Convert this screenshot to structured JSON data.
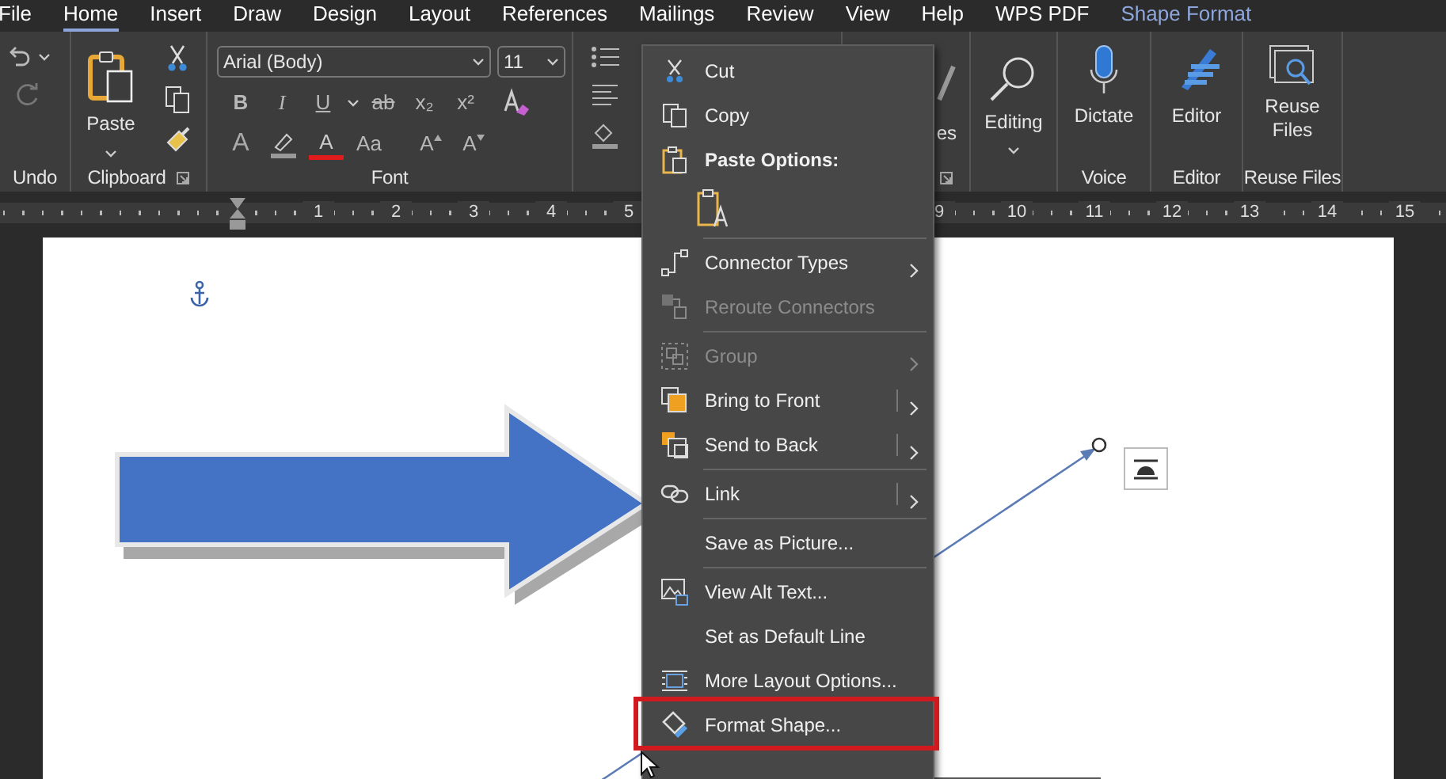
{
  "ribbon_tabs": [
    {
      "label": "File",
      "selected": false,
      "kind": "normal"
    },
    {
      "label": "Home",
      "selected": true,
      "kind": "normal"
    },
    {
      "label": "Insert",
      "selected": false,
      "kind": "normal"
    },
    {
      "label": "Draw",
      "selected": false,
      "kind": "normal"
    },
    {
      "label": "Design",
      "selected": false,
      "kind": "normal"
    },
    {
      "label": "Layout",
      "selected": false,
      "kind": "normal"
    },
    {
      "label": "References",
      "selected": false,
      "kind": "normal"
    },
    {
      "label": "Mailings",
      "selected": false,
      "kind": "normal"
    },
    {
      "label": "Review",
      "selected": false,
      "kind": "normal"
    },
    {
      "label": "View",
      "selected": false,
      "kind": "normal"
    },
    {
      "label": "Help",
      "selected": false,
      "kind": "normal"
    },
    {
      "label": "WPS PDF",
      "selected": false,
      "kind": "normal"
    },
    {
      "label": "Shape Format",
      "selected": false,
      "kind": "contextual"
    }
  ],
  "undo_group": {
    "label": "Undo"
  },
  "clipboard_group": {
    "paste_label": "Paste",
    "label": "Clipboard"
  },
  "font_group": {
    "font_name": "Arial (Body)",
    "font_size": "11",
    "format_buttons": [
      {
        "label": "B",
        "kind": "bold"
      },
      {
        "label": "I",
        "kind": "italic"
      },
      {
        "label": "U",
        "kind": "underline"
      },
      {
        "label": "ab",
        "kind": "strike"
      },
      {
        "label": "x₂",
        "kind": "plain"
      },
      {
        "label": "x²",
        "kind": "plain"
      }
    ],
    "style_buttons": [
      {
        "label": "A",
        "kind": "effects"
      },
      {
        "kind": "highlight"
      },
      {
        "label": "A",
        "kind": "color"
      },
      {
        "label": "Aa",
        "kind": "case"
      },
      {
        "label": "A",
        "kind": "grow"
      },
      {
        "label": "A",
        "kind": "shrink"
      }
    ],
    "label": "Font"
  },
  "styles_group": {
    "button_label": "es"
  },
  "editing_group": {
    "button_label": "Editing"
  },
  "voice_group": {
    "button_label": "Dictate",
    "label": "Voice"
  },
  "editor_group": {
    "button_label": "Editor",
    "label": "Editor"
  },
  "reuse_files_group": {
    "button_label": "Reuse Files",
    "label": "Reuse Files"
  },
  "ruler": {
    "numbers": [
      "1",
      "2",
      "3",
      "4",
      "5",
      "9",
      "10",
      "11",
      "12",
      "13",
      "14",
      "15"
    ]
  },
  "context_menu": {
    "items": [
      {
        "kind": "command",
        "label": "Cut",
        "disabled": false,
        "has_submenu": false,
        "split": false,
        "annotated": false
      },
      {
        "kind": "command",
        "label": "Copy",
        "disabled": false,
        "has_submenu": false,
        "split": false,
        "annotated": false
      },
      {
        "kind": "header",
        "label": "Paste Options:"
      },
      {
        "kind": "paste-options"
      },
      {
        "kind": "separator"
      },
      {
        "kind": "command",
        "label": "Connector Types",
        "disabled": false,
        "has_submenu": true,
        "split": false,
        "annotated": false
      },
      {
        "kind": "command",
        "label": "Reroute Connectors",
        "disabled": true,
        "has_submenu": false,
        "split": false,
        "annotated": false
      },
      {
        "kind": "separator"
      },
      {
        "kind": "command",
        "label": "Group",
        "disabled": true,
        "has_submenu": true,
        "split": false,
        "annotated": false
      },
      {
        "kind": "command",
        "label": "Bring to Front",
        "disabled": false,
        "has_submenu": true,
        "split": true,
        "annotated": false
      },
      {
        "kind": "command",
        "label": "Send to Back",
        "disabled": false,
        "has_submenu": true,
        "split": true,
        "annotated": false
      },
      {
        "kind": "separator"
      },
      {
        "kind": "command",
        "label": "Link",
        "disabled": false,
        "has_submenu": true,
        "split": true,
        "annotated": false
      },
      {
        "kind": "separator"
      },
      {
        "kind": "command",
        "label": "Save as Picture...",
        "disabled": false,
        "has_submenu": false,
        "split": false,
        "annotated": false
      },
      {
        "kind": "separator"
      },
      {
        "kind": "command",
        "label": "View Alt Text...",
        "disabled": false,
        "has_submenu": false,
        "split": false,
        "annotated": false
      },
      {
        "kind": "command",
        "label": "Set as Default Line",
        "disabled": false,
        "has_submenu": false,
        "split": false,
        "annotated": false
      },
      {
        "kind": "command",
        "label": "More Layout Options...",
        "disabled": false,
        "has_submenu": false,
        "split": false,
        "annotated": false
      },
      {
        "kind": "command",
        "label": "Format Shape...",
        "disabled": false,
        "has_submenu": false,
        "split": false,
        "annotated": true
      }
    ]
  }
}
